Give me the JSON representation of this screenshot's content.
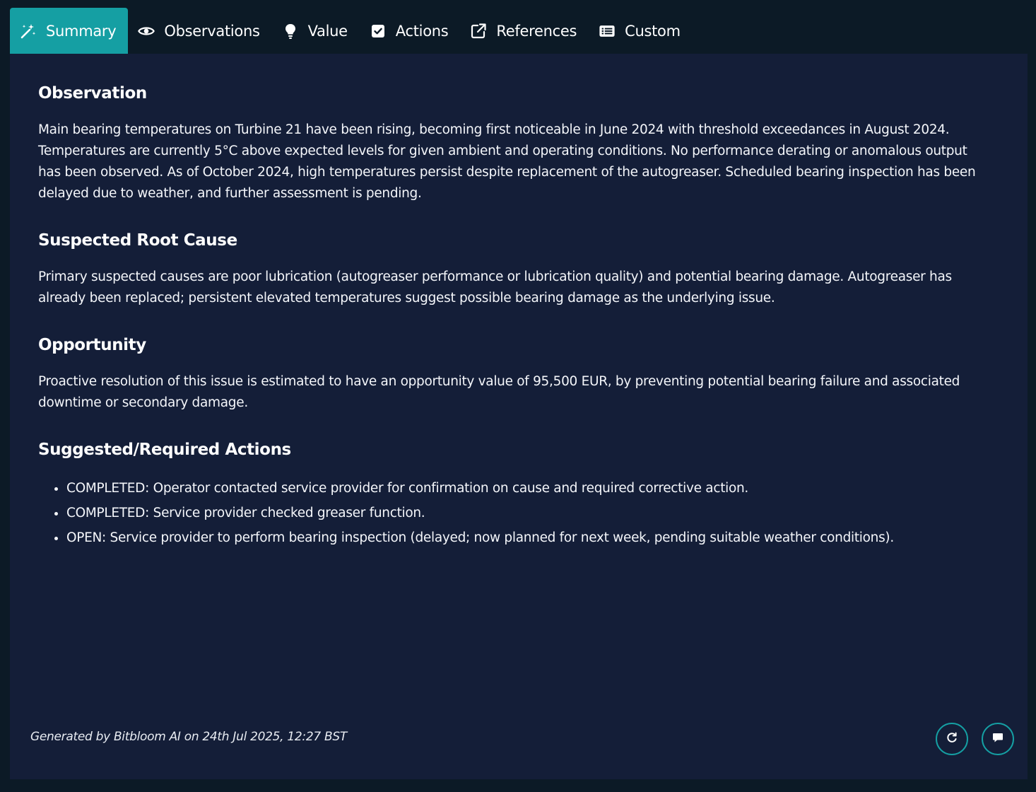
{
  "tabs": [
    {
      "label": "Summary",
      "icon": "magic-wand-icon",
      "active": true
    },
    {
      "label": "Observations",
      "icon": "eye-icon",
      "active": false
    },
    {
      "label": "Value",
      "icon": "lightbulb-icon",
      "active": false
    },
    {
      "label": "Actions",
      "icon": "checkbox-icon",
      "active": false
    },
    {
      "label": "References",
      "icon": "external-link-icon",
      "active": false
    },
    {
      "label": "Custom",
      "icon": "list-icon",
      "active": false
    }
  ],
  "summary": {
    "observation": {
      "heading": "Observation",
      "text": "Main bearing temperatures on Turbine 21 have been rising, becoming first noticeable in June 2024 with threshold exceedances in August 2024. Temperatures are currently 5°C above expected levels for given ambient and operating conditions. No performance derating or anomalous output has been observed. As of October 2024, high temperatures persist despite replacement of the autogreaser. Scheduled bearing inspection has been delayed due to weather, and further assessment is pending."
    },
    "root_cause": {
      "heading": "Suspected Root Cause",
      "text": "Primary suspected causes are poor lubrication (autogreaser performance or lubrication quality) and potential bearing damage. Autogreaser has already been replaced; persistent elevated temperatures suggest possible bearing damage as the underlying issue."
    },
    "opportunity": {
      "heading": "Opportunity",
      "text": "Proactive resolution of this issue is estimated to have an opportunity value of 95,500 EUR, by preventing potential bearing failure and associated downtime or secondary damage."
    },
    "actions": {
      "heading": "Suggested/Required Actions",
      "items": [
        "COMPLETED: Operator contacted service provider for confirmation on cause and required corrective action.",
        "COMPLETED: Service provider checked greaser function.",
        "OPEN: Service provider to perform bearing inspection (delayed; now planned for next week, pending suitable weather conditions)."
      ]
    }
  },
  "footer": {
    "generated_text": "Generated by Bitbloom AI on 24th Jul 2025, 12:27 BST"
  },
  "colors": {
    "page_bg": "#0c1a26",
    "panel_bg": "#141e38",
    "accent": "#159fa3"
  }
}
